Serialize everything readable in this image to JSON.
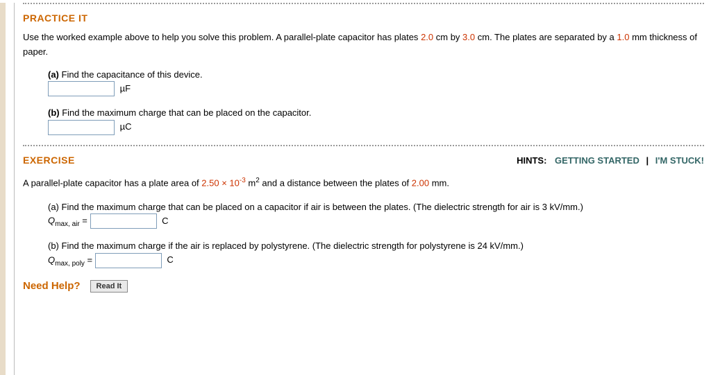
{
  "practice": {
    "title": "PRACTICE IT",
    "intro_1": "Use the worked example above to help you solve this problem. A parallel-plate capacitor has plates ",
    "val1": "2.0",
    "unit_cm1": " cm by ",
    "val2": "3.0",
    "unit_cm2": " cm. The plates are separated by a ",
    "val3": "1.0",
    "intro_2": " mm thickness of paper.",
    "part_a": {
      "label": "(a)",
      "text": " Find the capacitance of this device.",
      "unit": "µF"
    },
    "part_b": {
      "label": "(b)",
      "text": " Find the maximum charge that can be placed on the capacitor.",
      "unit": "µC"
    }
  },
  "exercise": {
    "title": "EXERCISE",
    "hints_label": "HINTS:",
    "hint1": "GETTING STARTED",
    "sep": "|",
    "hint2": "I'M STUCK!",
    "intro_pre": "A parallel-plate capacitor has a plate area of ",
    "area_val": "2.50 × 10",
    "area_exp": "-3",
    "area_unit_pre": " m",
    "area_unit_exp": "2",
    "intro_mid": " and a distance between the plates of ",
    "dist_val": "2.00",
    "intro_post": " mm.",
    "part_a": {
      "text": "(a) Find the maximum charge that can be placed on a capacitor if air is between the plates. (The dielectric strength for air is 3 kV/mm.)",
      "symbol": "Q",
      "sub": "max, air",
      "eq": " = ",
      "unit": "C"
    },
    "part_b": {
      "text": "(b) Find the maximum charge if the air is replaced by polystyrene. (The dielectric strength for polystyrene is 24 kV/mm.)",
      "symbol": "Q",
      "sub": "max, poly",
      "eq": " = ",
      "unit": "C"
    }
  },
  "help": {
    "label": "Need Help?",
    "readit": "Read It"
  }
}
